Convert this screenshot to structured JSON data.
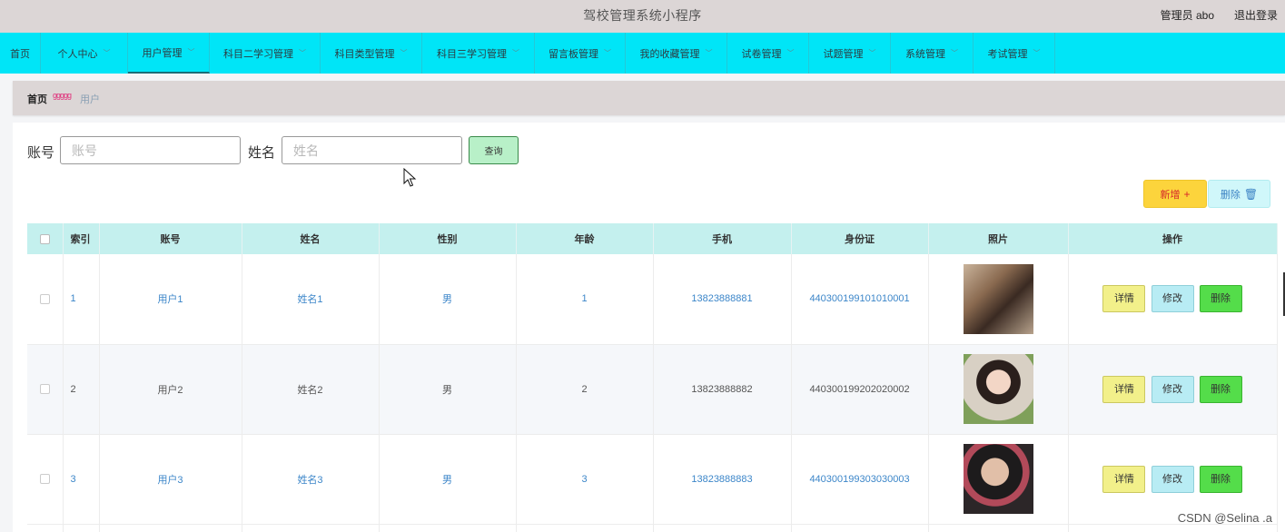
{
  "header": {
    "title": "驾校管理系统小程序",
    "user": "管理员 abo",
    "logout": "退出登录"
  },
  "nav": [
    {
      "label": "首页",
      "has_chevron": false,
      "active": false
    },
    {
      "label": "个人中心",
      "has_chevron": true,
      "active": false
    },
    {
      "label": "用户管理",
      "has_chevron": true,
      "active": true
    },
    {
      "label": "科目二学习管理",
      "has_chevron": true,
      "active": false
    },
    {
      "label": "科目类型管理",
      "has_chevron": true,
      "active": false
    },
    {
      "label": "科目三学习管理",
      "has_chevron": true,
      "active": false
    },
    {
      "label": "留言板管理",
      "has_chevron": true,
      "active": false
    },
    {
      "label": "我的收藏管理",
      "has_chevron": true,
      "active": false
    },
    {
      "label": "试卷管理",
      "has_chevron": true,
      "active": false
    },
    {
      "label": "试题管理",
      "has_chevron": true,
      "active": false
    },
    {
      "label": "系统管理",
      "has_chevron": true,
      "active": false
    },
    {
      "label": "考试管理",
      "has_chevron": true,
      "active": false
    }
  ],
  "breadcrumb": {
    "home": "首页",
    "separator": "ggggg",
    "current": "用户"
  },
  "search": {
    "account_label": "账号",
    "account_placeholder": "账号",
    "name_label": "姓名",
    "name_placeholder": "姓名",
    "query_button": "查询"
  },
  "actions": {
    "add_label": "新增",
    "add_icon": "+",
    "delete_label": "删除",
    "delete_icon": "🗑"
  },
  "table": {
    "columns": [
      "索引",
      "账号",
      "姓名",
      "性别",
      "年龄",
      "手机",
      "身份证",
      "照片",
      "操作"
    ],
    "rows": [
      {
        "index": "1",
        "account": "用户1",
        "name": "姓名1",
        "gender": "男",
        "age": "1",
        "phone": "13823888881",
        "id_card": "440300199101010001"
      },
      {
        "index": "2",
        "account": "用户2",
        "name": "姓名2",
        "gender": "男",
        "age": "2",
        "phone": "13823888882",
        "id_card": "440300199202020002"
      },
      {
        "index": "3",
        "account": "用户3",
        "name": "姓名3",
        "gender": "男",
        "age": "3",
        "phone": "13823888883",
        "id_card": "440300199303030003"
      }
    ],
    "op_detail": "详情",
    "op_edit": "修改",
    "op_delete": "删除"
  },
  "watermark": "CSDN @Selina .a",
  "colors": {
    "topbar": "#dcd6d6",
    "nav": "#00e5f7",
    "table_header": "#c4f0ee",
    "link_blue": "#3c86c9",
    "query_green": "#b8f0c8",
    "add_yellow": "#fcd43c",
    "delete_green": "#54dd4a"
  }
}
